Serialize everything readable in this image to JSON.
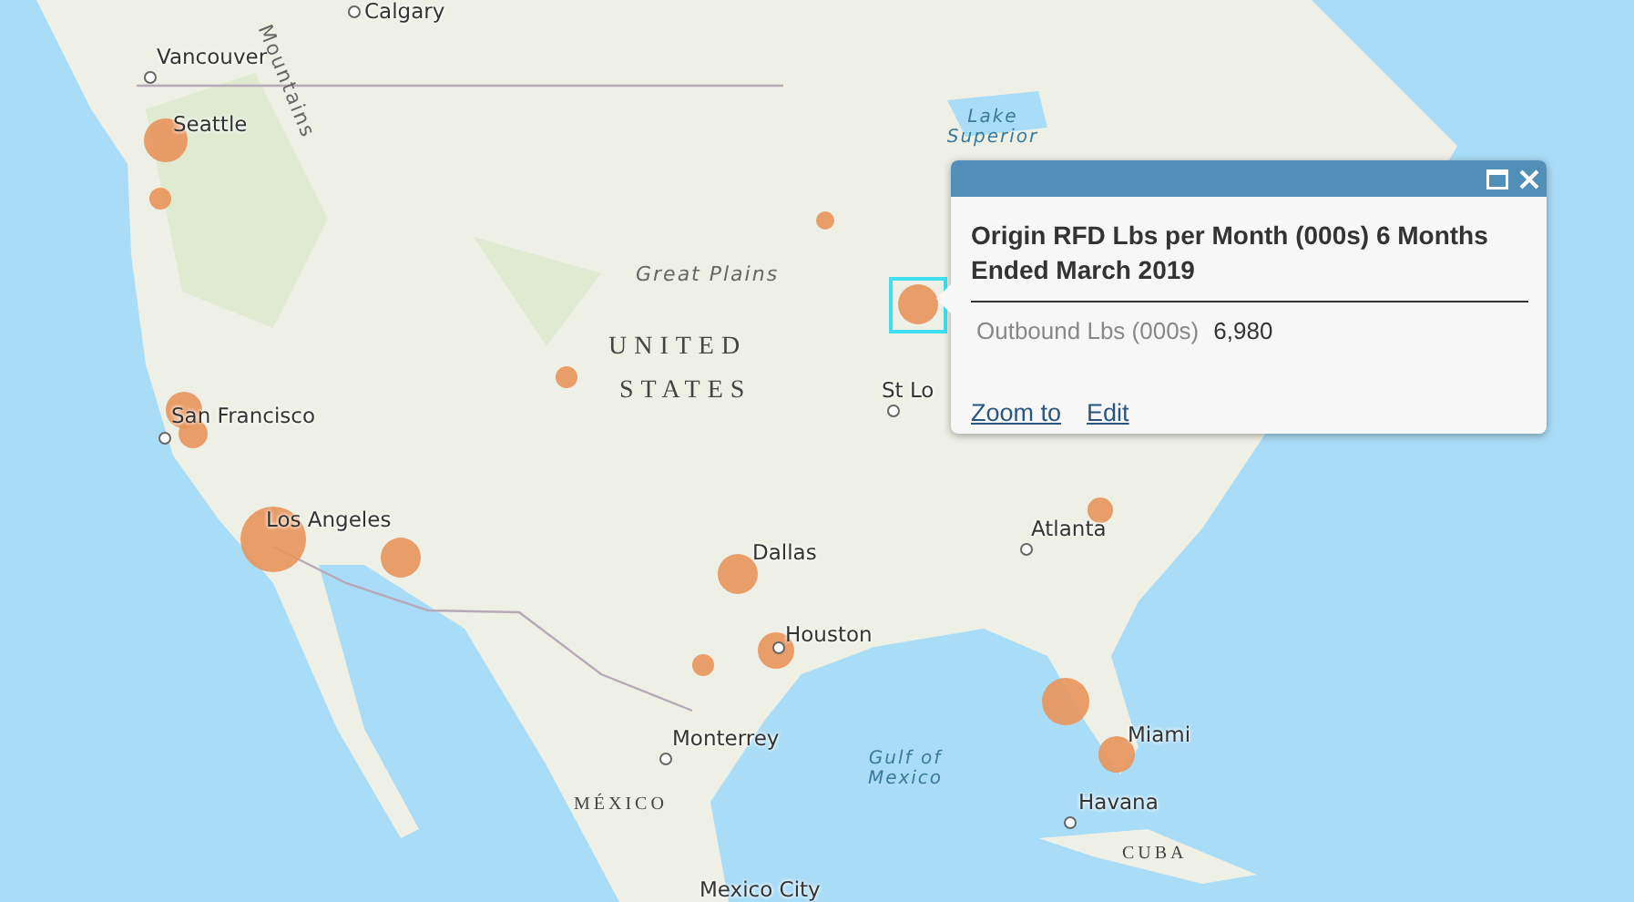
{
  "map": {
    "labels": [
      {
        "text": "Calgary",
        "kind": "city"
      },
      {
        "text": "Vancouver",
        "kind": "city"
      },
      {
        "text": "Seattle",
        "kind": "city"
      },
      {
        "text": "San Francisco",
        "kind": "city"
      },
      {
        "text": "Los Angeles",
        "kind": "city"
      },
      {
        "text": "Dallas",
        "kind": "city"
      },
      {
        "text": "Houston",
        "kind": "city"
      },
      {
        "text": "Monterrey",
        "kind": "city"
      },
      {
        "text": "Mexico City",
        "kind": "city"
      },
      {
        "text": "Atlanta",
        "kind": "city"
      },
      {
        "text": "Miami",
        "kind": "city"
      },
      {
        "text": "Havana",
        "kind": "city"
      },
      {
        "text": "St Lo",
        "kind": "city"
      },
      {
        "text": "Great Plains",
        "kind": "region"
      },
      {
        "text": "UNITED",
        "kind": "country"
      },
      {
        "text": "STATES",
        "kind": "country"
      },
      {
        "text": "MÉXICO",
        "kind": "country-small"
      },
      {
        "text": "CUBA",
        "kind": "country-small"
      },
      {
        "text": "Lake Superior",
        "kind": "water"
      },
      {
        "text": "Gulf of Mexico",
        "kind": "water"
      },
      {
        "text": "Mountains",
        "kind": "range"
      }
    ]
  },
  "popup": {
    "title": "Origin RFD Lbs per Month (000s) 6 Months Ended March 2019",
    "field": {
      "label": "Outbound Lbs (000s)",
      "value": "6,980"
    },
    "actions": [
      "Zoom to",
      "Edit"
    ]
  }
}
